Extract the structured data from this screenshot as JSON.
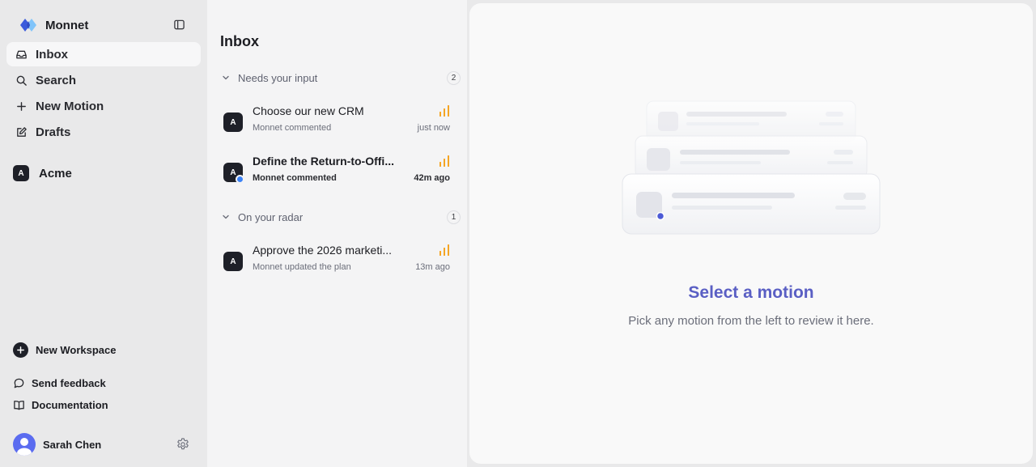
{
  "app": {
    "name": "Monnet",
    "accent": "#5a5fc4",
    "brand_colors": [
      "#3b5bdb",
      "#74c0fc"
    ]
  },
  "sidebar": {
    "nav": [
      {
        "label": "Inbox",
        "icon": "inbox-icon",
        "active": true
      },
      {
        "label": "Search",
        "icon": "search-icon"
      },
      {
        "label": "New Motion",
        "icon": "plus-icon"
      },
      {
        "label": "Drafts",
        "icon": "edit-icon"
      }
    ],
    "workspace": {
      "initial": "A",
      "name": "Acme"
    },
    "new_workspace": "New Workspace",
    "send_feedback": "Send feedback",
    "documentation": "Documentation",
    "user": {
      "name": "Sarah Chen"
    }
  },
  "inbox": {
    "title": "Inbox",
    "groups": [
      {
        "label": "Needs your input",
        "count": "2",
        "items": [
          {
            "initial": "A",
            "title": "Choose our new CRM",
            "subtitle": "Monnet commented",
            "time": "just now",
            "unread": false
          },
          {
            "initial": "A",
            "title": "Define the Return-to-Offi...",
            "subtitle": "Monnet commented",
            "time": "42m ago",
            "unread": true
          }
        ]
      },
      {
        "label": "On your radar",
        "count": "1",
        "items": [
          {
            "initial": "A",
            "title": "Approve the 2026 marketi...",
            "subtitle": "Monnet updated the plan",
            "time": "13m ago",
            "unread": false
          }
        ]
      }
    ]
  },
  "main": {
    "empty_title": "Select a motion",
    "empty_subtitle": "Pick any motion from the left to review it here."
  },
  "colors": {
    "priority": "#f5a524",
    "unread": "#3b82f6"
  }
}
